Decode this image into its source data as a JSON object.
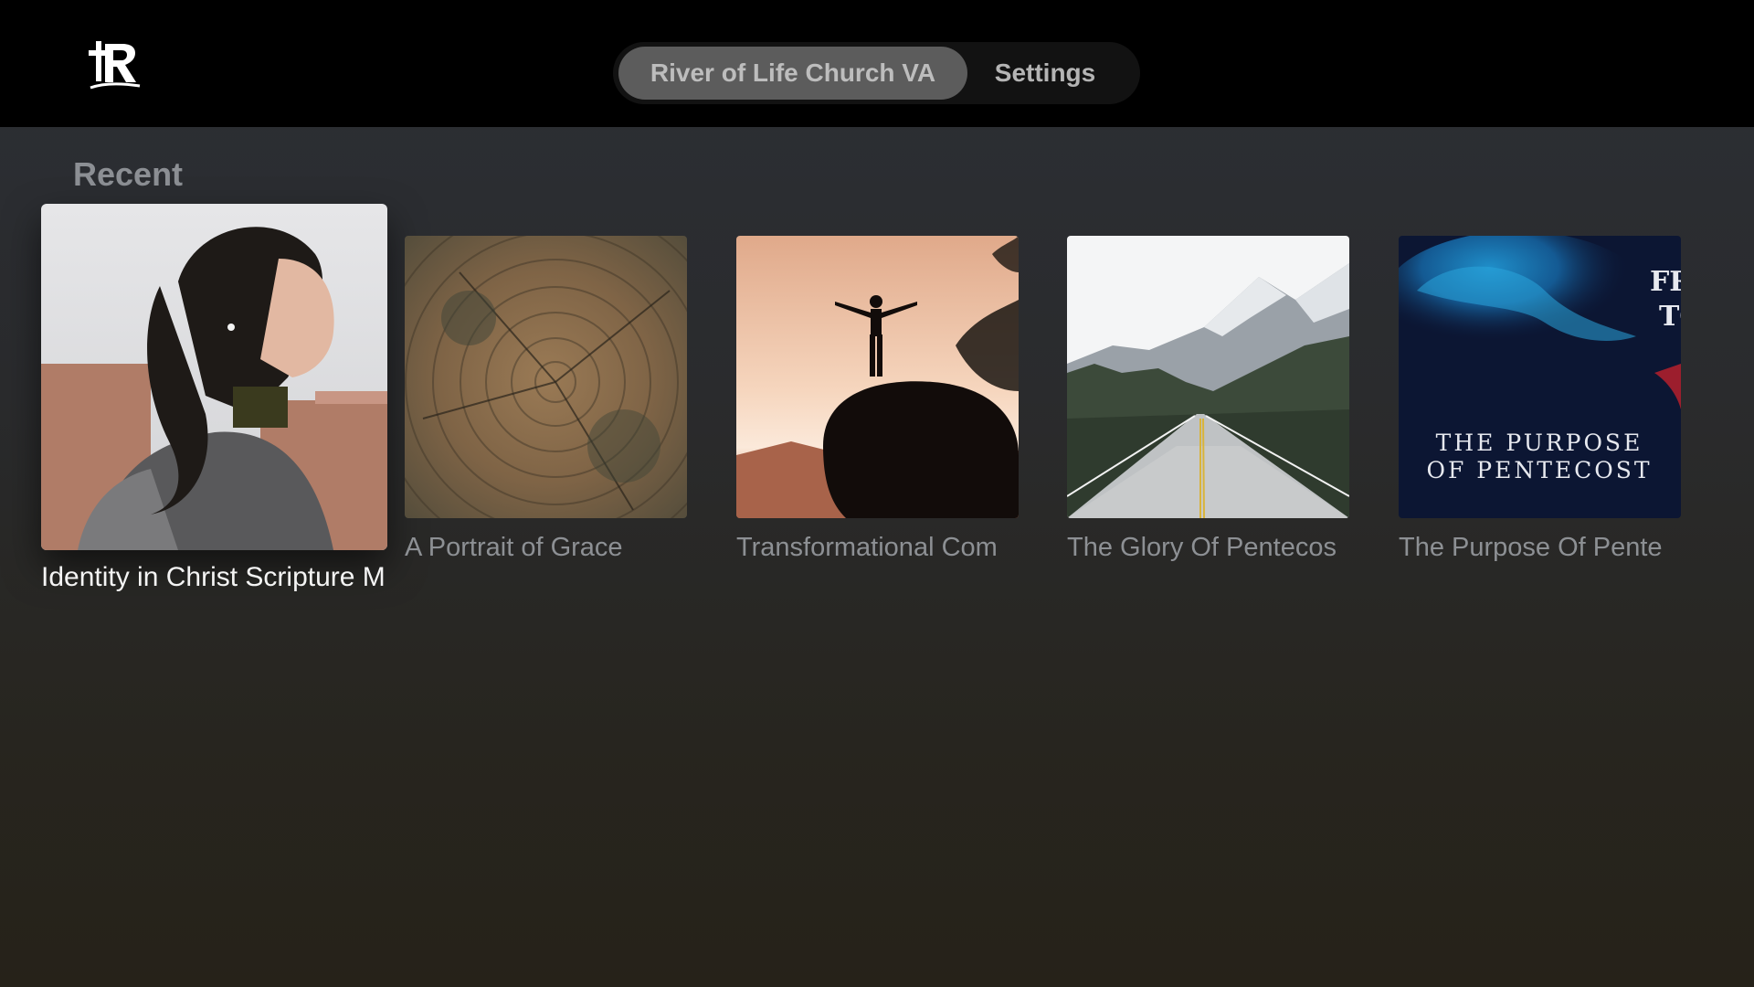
{
  "header": {
    "logo_icon": "river-of-life-logo-icon",
    "tabs": [
      {
        "label": "River of Life Church VA",
        "selected": true
      },
      {
        "label": "Settings",
        "selected": false
      }
    ]
  },
  "recent": {
    "title": "Recent",
    "items": [
      {
        "title": "Identity in Christ Scripture M",
        "image": "woman-profile-photo",
        "focused": true
      },
      {
        "title": "A Portrait of Grace",
        "image": "tree-rings-photo",
        "focused": false
      },
      {
        "title": "Transformational Com",
        "image": "silhouette-on-rock-photo",
        "focused": false
      },
      {
        "title": "The Glory Of Pentecos",
        "image": "mountain-road-photo",
        "focused": false
      },
      {
        "title": "The Purpose Of Pente",
        "image": "blue-smoke-artwork",
        "focused": false,
        "artwork_text": [
          "THE PURPOSE",
          "OF PENTECOST"
        ],
        "artwork_corner_text": [
          "FR",
          "TO"
        ]
      }
    ]
  },
  "colors": {
    "topbar": "#000000",
    "tab_active_bg": "#5c5c5c",
    "title_dim": "#8d9094",
    "title_focused": "#f4f4f4"
  }
}
